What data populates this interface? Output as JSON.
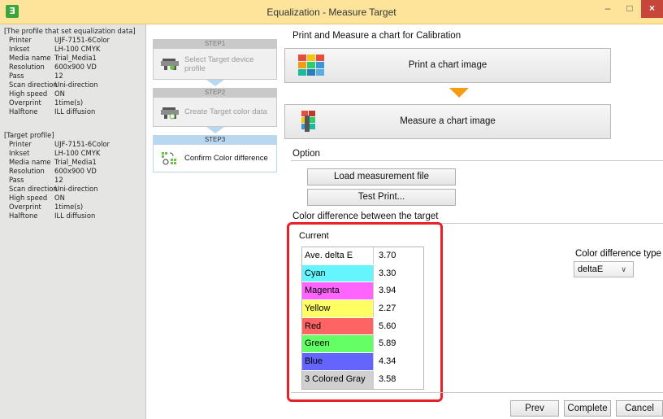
{
  "window": {
    "title": "Equalization - Measure Target",
    "app_icon_glyph": "Ǝ",
    "minimize_glyph": "–",
    "maximize_glyph": "□",
    "close_glyph": "×"
  },
  "profile_set": {
    "header": "[The profile that set equalization data]",
    "rows": [
      {
        "k": "Printer",
        "v": "UJF-7151-6Color"
      },
      {
        "k": "Inkset",
        "v": "LH-100 CMYK"
      },
      {
        "k": "Media name",
        "v": "Trial_Media1"
      },
      {
        "k": "Resolution",
        "v": "600x900 VD"
      },
      {
        "k": "Pass",
        "v": "12"
      },
      {
        "k": "Scan direction",
        "v": "Uni-direction"
      },
      {
        "k": "High speed",
        "v": "ON"
      },
      {
        "k": "Overprint",
        "v": "1time(s)"
      },
      {
        "k": "Halftone",
        "v": "ILL diffusion"
      }
    ]
  },
  "target_profile": {
    "header": "[Target profile]",
    "rows": [
      {
        "k": "Printer",
        "v": "UJF-7151-6Color"
      },
      {
        "k": "Inkset",
        "v": "LH-100 CMYK"
      },
      {
        "k": "Media name",
        "v": "Trial_Media1"
      },
      {
        "k": "Resolution",
        "v": "600x900 VD"
      },
      {
        "k": "Pass",
        "v": "12"
      },
      {
        "k": "Scan direction",
        "v": "Uni-direction"
      },
      {
        "k": "High speed",
        "v": "ON"
      },
      {
        "k": "Overprint",
        "v": "1time(s)"
      },
      {
        "k": "Halftone",
        "v": "ILL diffusion"
      }
    ]
  },
  "steps": [
    {
      "label": "STEP1",
      "text": "Select Target device profile",
      "active": false
    },
    {
      "label": "STEP2",
      "text": "Create Target color data",
      "active": false
    },
    {
      "label": "STEP3",
      "text": "Confirm Color difference",
      "active": true
    }
  ],
  "print_measure": {
    "section_title": "Print and Measure a chart for Calibration",
    "print_button": "Print a chart image",
    "measure_button": "Measure a chart image"
  },
  "option": {
    "section_title": "Option",
    "load_button": "Load measurement file",
    "test_print_button": "Test Print..."
  },
  "color_diff": {
    "section_title": "Color difference between the target",
    "current_label": "Current",
    "rows": [
      {
        "name": "Ave. delta E",
        "value": "3.70",
        "color": "#ffffff"
      },
      {
        "name": "Cyan",
        "value": "3.30",
        "color": "#64f5ff"
      },
      {
        "name": "Magenta",
        "value": "3.94",
        "color": "#ff64ff"
      },
      {
        "name": "Yellow",
        "value": "2.27",
        "color": "#ffff64"
      },
      {
        "name": "Red",
        "value": "5.60",
        "color": "#ff6464"
      },
      {
        "name": "Green",
        "value": "5.89",
        "color": "#64ff64"
      },
      {
        "name": "Blue",
        "value": "4.34",
        "color": "#6464ff"
      },
      {
        "name": "3 Colored Gray",
        "value": "3.58",
        "color": "#d0d0d0"
      }
    ],
    "type_label": "Color difference type",
    "type_selected": "deltaE"
  },
  "footer": {
    "prev": "Prev",
    "complete": "Complete",
    "cancel": "Cancel"
  }
}
